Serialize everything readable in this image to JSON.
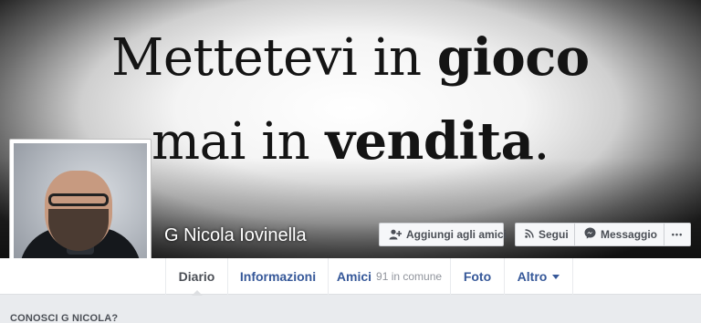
{
  "cover": {
    "quote_line1_normal": "Mettetevi in ",
    "quote_line1_bold": "gioco",
    "quote_line2_normal": "mai in ",
    "quote_line2_bold": "vendita",
    "quote_line2_end": "."
  },
  "profile": {
    "name": "G Nicola Iovinella"
  },
  "actions": {
    "add_friend_label": "Aggiungi agli amici",
    "add_friend_icon": "add-friend-icon",
    "follow_label": "Segui",
    "follow_icon": "rss-icon",
    "message_label": "Messaggio",
    "message_icon": "messenger-icon",
    "more_label": "•••"
  },
  "nav": {
    "tabs": [
      {
        "label": "Diario"
      },
      {
        "label": "Informazioni"
      },
      {
        "label": "Amici",
        "sub": "91 in comune"
      },
      {
        "label": "Foto"
      },
      {
        "label": "Altro"
      }
    ]
  },
  "section": {
    "title": "CONOSCI G NICOLA?"
  },
  "colors": {
    "link": "#365899",
    "background": "#e9ebee",
    "button_bg": "#f6f7f9"
  }
}
